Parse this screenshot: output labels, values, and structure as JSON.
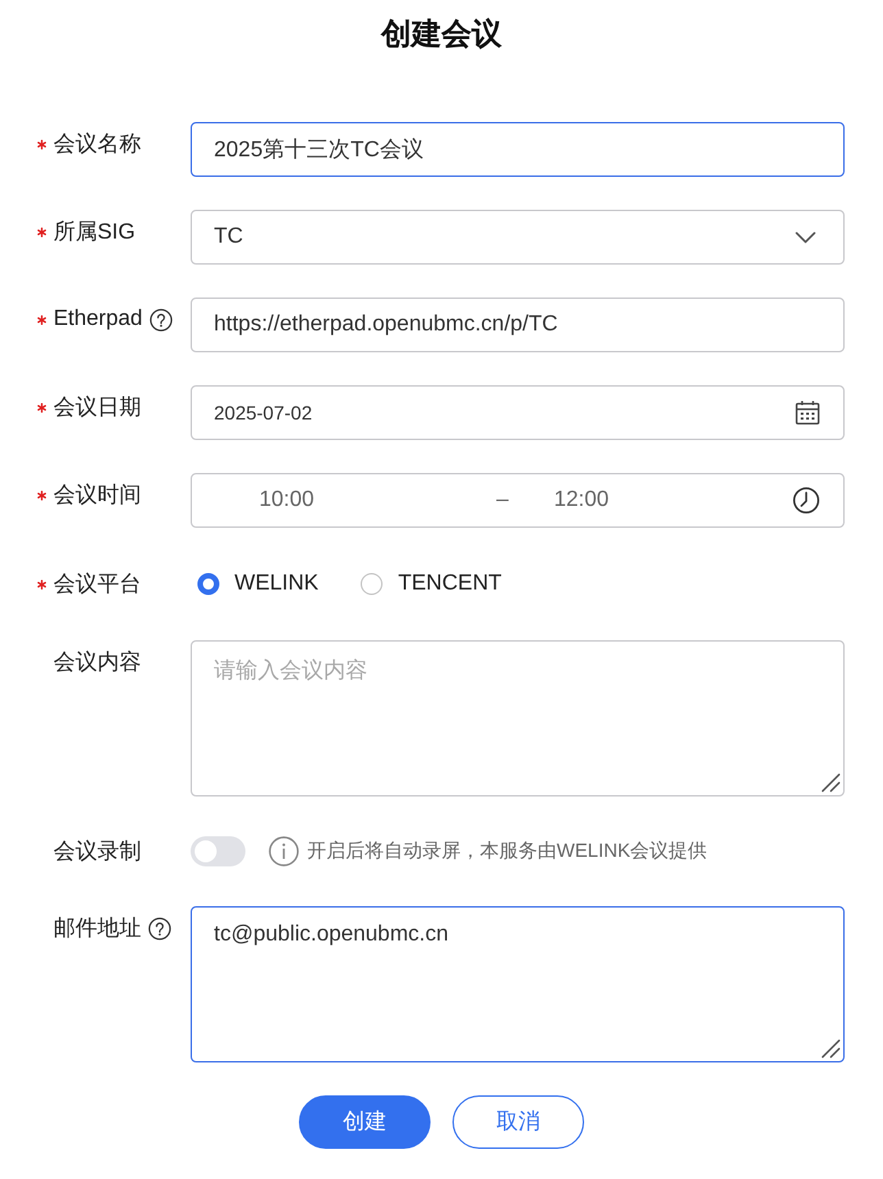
{
  "title": "创建会议",
  "fields": [
    {
      "kind": "text",
      "label": "会议名称",
      "required": true,
      "help": false,
      "focused": true,
      "value": "2025第十三次TC会议"
    },
    {
      "kind": "select",
      "label": "所属SIG",
      "required": true,
      "help": false,
      "focused": false,
      "value": "TC"
    },
    {
      "kind": "text",
      "label": "Etherpad",
      "required": true,
      "help": true,
      "focused": false,
      "value": "https://etherpad.openubmc.cn/p/TC"
    },
    {
      "kind": "date",
      "label": "会议日期",
      "required": true,
      "help": false,
      "focused": false,
      "value": "2025-07-02"
    },
    {
      "kind": "time_range",
      "label": "会议时间",
      "required": true,
      "help": false,
      "focused": false,
      "start": "10:00",
      "separator": "–",
      "end": "12:00"
    },
    {
      "kind": "radio",
      "label": "会议平台",
      "required": true,
      "help": false,
      "options": [
        {
          "label": "WELINK",
          "selected": true
        },
        {
          "label": "TENCENT",
          "selected": false
        }
      ]
    },
    {
      "kind": "textarea",
      "label": "会议内容",
      "required": false,
      "help": false,
      "focused": false,
      "placeholder": "请输入会议内容"
    },
    {
      "kind": "switch",
      "label": "会议录制",
      "required": false,
      "help": false,
      "on": false,
      "hint": "开启后将自动录屏，本服务由WELINK会议提供"
    },
    {
      "kind": "textarea",
      "label": "邮件地址",
      "required": false,
      "help": true,
      "focused": true,
      "value": "tc@public.openubmc.cn"
    }
  ],
  "buttons": [
    {
      "kind": "primary",
      "label": "创建"
    },
    {
      "kind": "secondary",
      "label": "取消"
    }
  ]
}
